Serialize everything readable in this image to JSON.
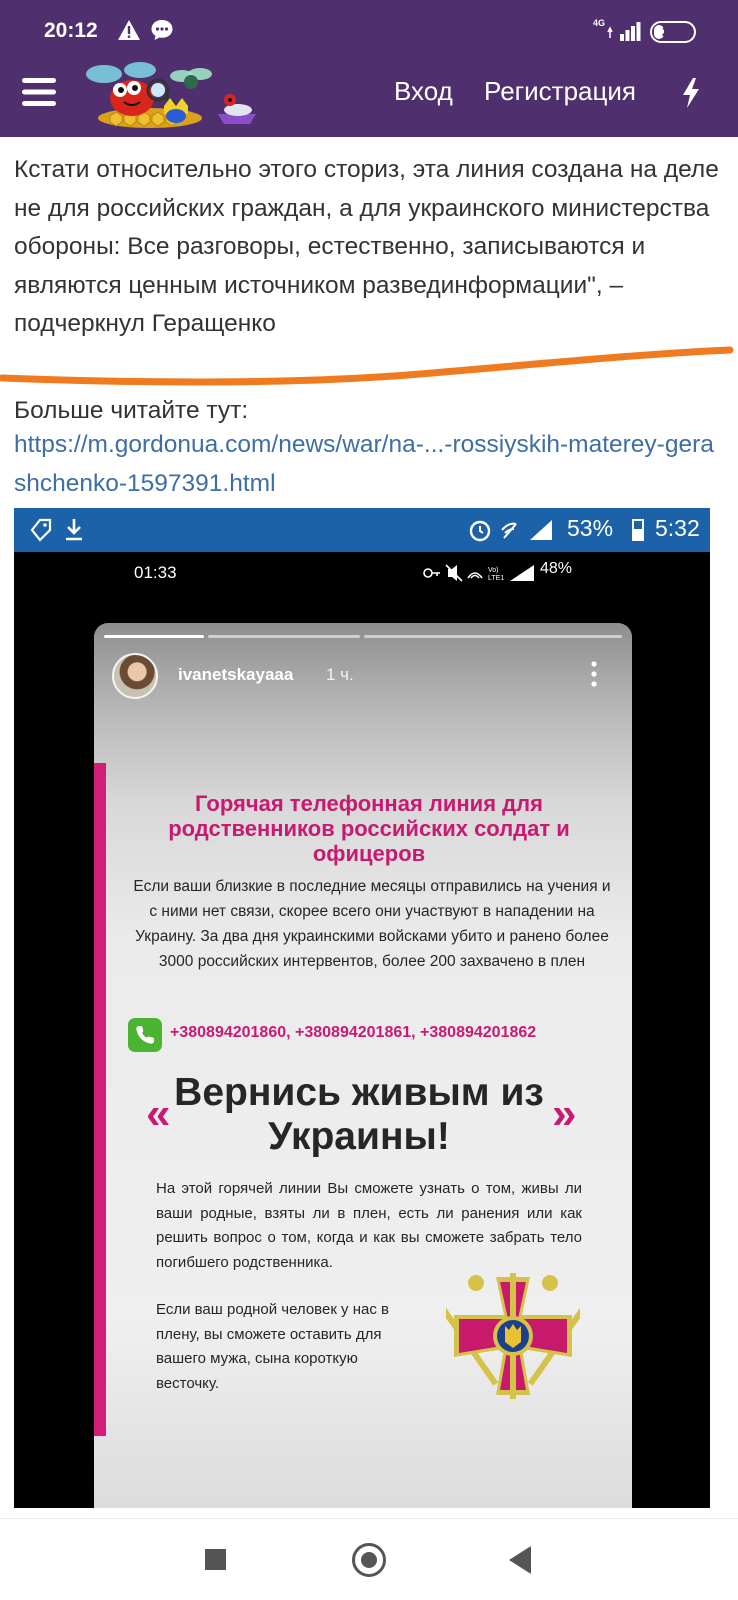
{
  "status_bar": {
    "time": "20:12",
    "network": "4G",
    "battery": "26",
    "battery_level": 0.26
  },
  "header": {
    "login": "Вход",
    "register": "Регистрация",
    "menu_icon": "hamburger-menu-icon",
    "bolt_icon": "lightning-icon"
  },
  "article": {
    "quote": "Кстати относительно этого сториз, эта линия создана на деле не для российских граждан, а для украинского министерства обороны: Все разговоры, естественно, записываются и являются ценным источником развединформации\", – подчеркнул Геращенко",
    "read_more": "Больше читайте тут:",
    "link": "https://m.gordonua.com/news/war/na-...-rossiyskih-materey-gerashchenko-1597391.html",
    "underline_color": "#f07a1f"
  },
  "screenshot": {
    "outer_status": {
      "battery_pct": "53%",
      "time": "5:32",
      "bar_color": "#1c62a8"
    },
    "inner_status": {
      "time": "01:33",
      "battery": "48%"
    },
    "story": {
      "username": "ivanetskayaaa",
      "age": "1 ч.",
      "flyer": {
        "title": "Горячая телефонная линия для родственников российских солдат и офицеров",
        "intro": "Если ваши близкие в последние месяцы отправились на учения и с ними нет связи, скорее всего они участвуют в нападении на Украину. За два дня украинскими войсками убито и ранено более 3000 российских интервентов, более 200 захвачено в плен",
        "phones": "+380894201860, +380894201861, +380894201862",
        "quote_open": "«",
        "slogan": "Вернись живым из Украины!",
        "quote_close": "»",
        "para1": "На этой горячей линии Вы сможете узнать о том, живы ли ваши родные, взяты ли в плен, есть ли ранения или как решить вопрос о том, когда и как вы сможете забрать тело погибшего родственника.",
        "para2": "Если ваш родной человек у нас в плену, вы сможете оставить для вашего мужа, сына короткую весточку.",
        "accent_color": "#c81a72"
      }
    }
  }
}
